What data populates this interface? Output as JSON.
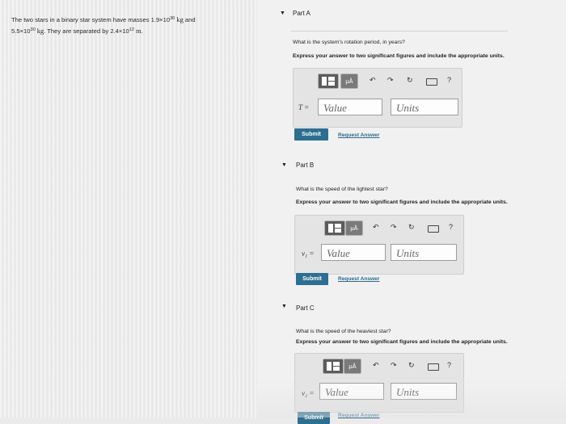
{
  "problem": {
    "text_a": "The two stars in a binary star system have masses 1.9×10",
    "exp1": "30",
    "unit1": " kg",
    "text_b": " and",
    "line2_a": "5.5×10",
    "exp2": "30",
    "unit2": " kg",
    "line2_b": ". They are separated by 2.4×10",
    "exp3": "12",
    "unit3": " m",
    "line2_c": "."
  },
  "parts": [
    {
      "title": "Part A",
      "question": "What is the system's rotation period, in years?",
      "instruction": "Express your answer to two significant figures and include the appropriate units.",
      "variable": "T =",
      "value_placeholder": "Value",
      "units_placeholder": "Units",
      "submit_label": "Submit",
      "request_label": "Request Answer"
    },
    {
      "title": "Part B",
      "question": "What is the speed of the lightest star?",
      "instruction": "Express your answer to two significant figures and include the appropriate units.",
      "variable": "v₁ =",
      "value_placeholder": "Value",
      "units_placeholder": "Units",
      "submit_label": "Submit",
      "request_label": "Request Answer"
    },
    {
      "title": "Part C",
      "question": "What is the speed of the heaviest star?",
      "instruction": "Express your answer to two significant figures and include the appropriate units.",
      "variable": "v₂ =",
      "value_placeholder": "Value",
      "units_placeholder": "Units",
      "submit_label": "Submit",
      "request_label": "Request Answer"
    }
  ],
  "toolbar": {
    "mu_label": "μÅ",
    "undo_glyph": "↶",
    "redo_glyph": "↷",
    "reset_glyph": "↻",
    "help_glyph": "?"
  },
  "icons": {
    "caret": "caret-down-icon",
    "templates": "templates-icon",
    "units": "units-mu-icon",
    "undo": "undo-icon",
    "redo": "redo-icon",
    "reset": "reset-icon",
    "keyboard": "keyboard-icon",
    "help": "help-icon"
  },
  "colors": {
    "submit_bg": "#2b6f91",
    "link": "#2d6b8b",
    "toolbar_dark": "#5b5b5b"
  }
}
